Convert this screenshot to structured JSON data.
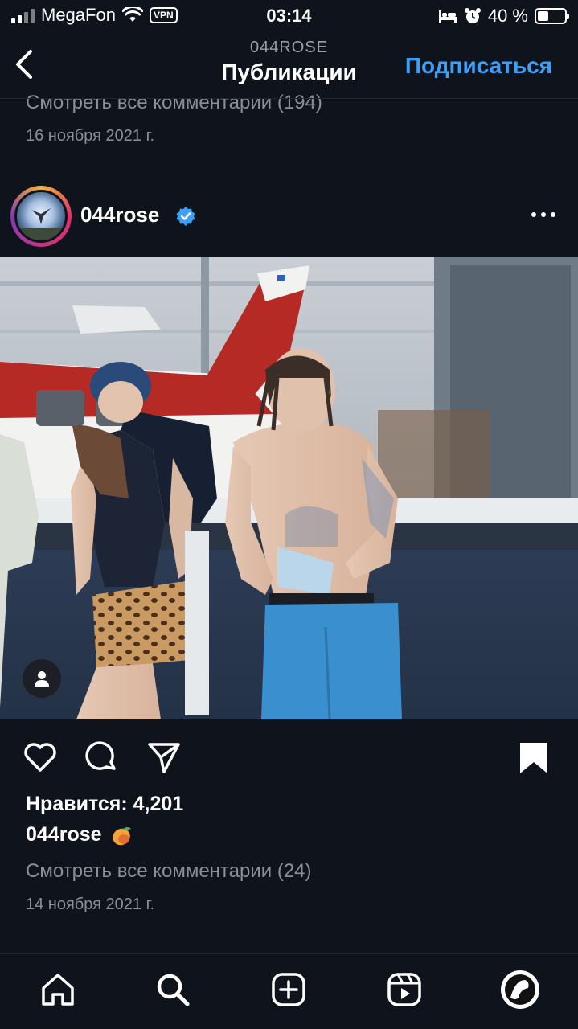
{
  "status_bar": {
    "carrier": "MegaFon",
    "vpn": "VPN",
    "time": "03:14",
    "battery_text": "40 %",
    "battery_level": 0.4
  },
  "header": {
    "subtitle": "044ROSE",
    "title": "Публикации",
    "follow_label": "Подписаться"
  },
  "previous_post": {
    "comments_link": "Смотреть все комментарии (194)",
    "date": "16 ноября 2021 г."
  },
  "post": {
    "username": "044rose",
    "verified_icon": "verified-badge-icon",
    "likes": "Нравится: 4,201",
    "caption_user": "044rose",
    "caption_emoji": "mango-icon",
    "comments_link": "Смотреть все комментарии (24)",
    "date": "14 ноября 2021 г."
  },
  "icons": {
    "like": "heart-icon",
    "comment": "comment-bubble-icon",
    "share": "paper-plane-icon",
    "save": "bookmark-icon",
    "tag": "person-tag-icon"
  },
  "tabbar": [
    "home-icon",
    "search-icon",
    "create-icon",
    "reels-icon",
    "profile-avatar"
  ],
  "colors": {
    "background": "#0f141c",
    "accent": "#3d9ff5",
    "muted_text": "#8a9098"
  }
}
